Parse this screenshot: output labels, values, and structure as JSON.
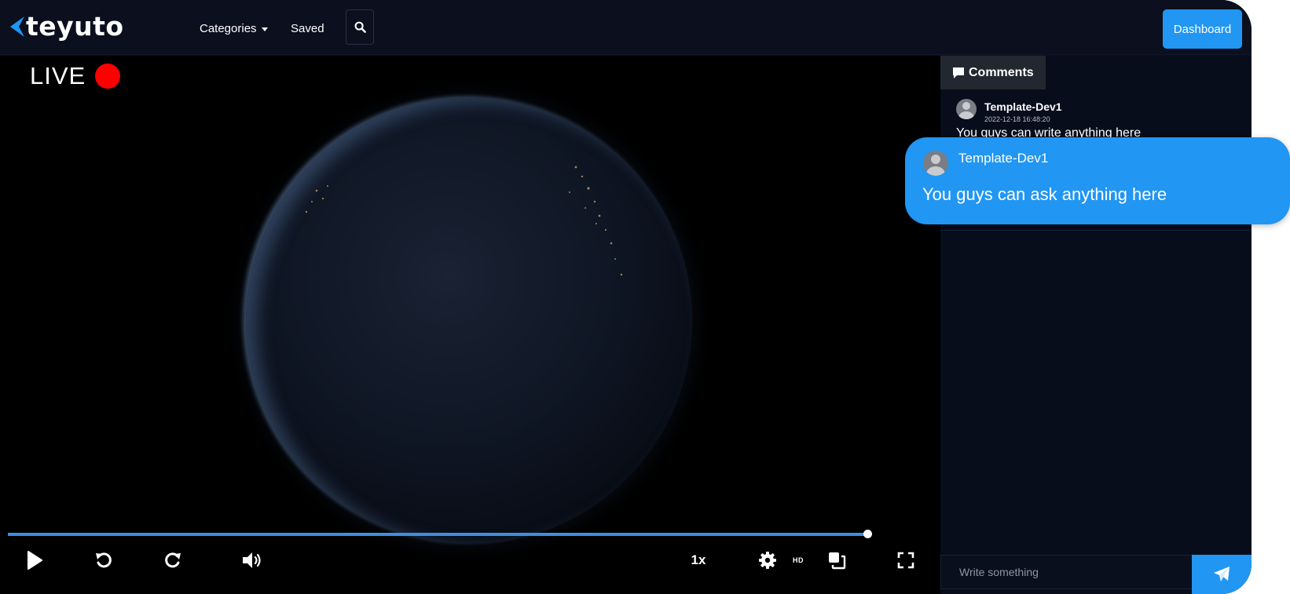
{
  "header": {
    "logo_text": "teyuto",
    "nav": {
      "categories_label": "Categories",
      "saved_label": "Saved"
    },
    "search_icon": "search-icon",
    "dashboard_label": "Dashboard"
  },
  "player": {
    "live_label": "LIVE",
    "live_dot_color": "#ff0000",
    "progress_fraction": 1.0,
    "speed_label": "1x",
    "hd_label": "HD",
    "icons": [
      "play-icon",
      "rewind-icon",
      "forward-icon",
      "volume-icon",
      "settings-icon",
      "pip-icon",
      "fullscreen-icon"
    ]
  },
  "comments": {
    "tab_label": "Comments",
    "items": [
      {
        "user": "Template-Dev1",
        "timestamp": "2022-12-18 16:48:20",
        "text": "You guys can write anything here"
      }
    ],
    "input_placeholder": "Write something",
    "send_icon": "send-icon"
  },
  "bubble": {
    "user": "Template-Dev1",
    "text": "You guys can ask anything here"
  },
  "colors": {
    "accent": "#2196f3",
    "background": "#0a0f1f",
    "live": "#ff0000"
  }
}
